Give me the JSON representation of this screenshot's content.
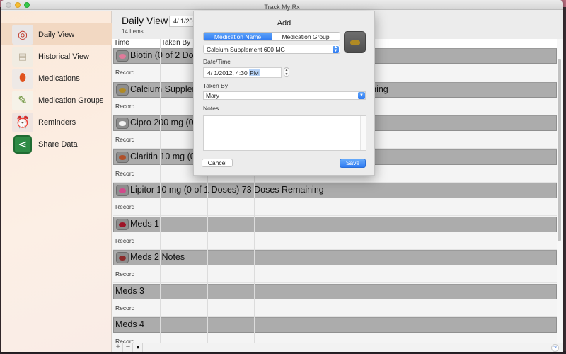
{
  "window": {
    "title": "Track My Rx"
  },
  "sidebar": {
    "items": [
      {
        "label": "Daily View",
        "icon": "calendar-pills-icon",
        "active": true
      },
      {
        "label": "Historical View",
        "icon": "history-paper-icon",
        "active": false
      },
      {
        "label": "Medications",
        "icon": "pill-bottle-icon",
        "active": false
      },
      {
        "label": "Medication Groups",
        "icon": "spoon-pills-icon",
        "active": false
      },
      {
        "label": "Reminders",
        "icon": "alarm-clock-icon",
        "active": false
      },
      {
        "label": "Share Data",
        "icon": "share-icon",
        "active": false
      }
    ]
  },
  "main": {
    "title": "Daily View",
    "date_value": "4/ 1/2012",
    "items_count": "14 Items",
    "columns": [
      "Time",
      "Taken By",
      "",
      ""
    ],
    "groups": [
      {
        "text": "Biotin (0 of 2 Doses)",
        "pill_color": "#e07a9a",
        "has_icon": true
      },
      {
        "text": "Calcium Supplement 600 MG (0 of 1 Doses) 98 Doses Remaining",
        "pill_color": "#b08a24",
        "has_icon": true
      },
      {
        "text": "Cipro 200 mg (0 of 2 Doses)",
        "pill_color": "#f4f4f4",
        "has_icon": true
      },
      {
        "text": "Claritin 10 mg (0 of 1 Doses)",
        "pill_color": "#b0502a",
        "has_icon": true
      },
      {
        "text": "Lipitor 10 mg (0 of 1 Doses) 73 Doses Remaining",
        "pill_color": "#d04a8a",
        "has_icon": true
      },
      {
        "text": "Meds 1",
        "pill_color": "#9e1428",
        "has_icon": true
      },
      {
        "text": "Meds 2 Notes",
        "pill_color": "#8a2a2a",
        "has_icon": true
      },
      {
        "text": "Meds 3",
        "pill_color": "",
        "has_icon": false
      },
      {
        "text": "Meds 4",
        "pill_color": "",
        "has_icon": false
      }
    ],
    "record_label": "Record",
    "bottom_bar": {
      "add": "+",
      "remove": "−",
      "action": "●",
      "help": "?"
    }
  },
  "dialog": {
    "title": "Add",
    "segments": [
      {
        "label": "Medication Name",
        "selected": true
      },
      {
        "label": "Medication Group",
        "selected": false
      }
    ],
    "medication_select": "Calcium Supplement 600 MG",
    "datetime_label": "Date/Time",
    "datetime_value": "4/ 1/2012,  4:30 ",
    "datetime_ampm": "PM",
    "taken_by_label": "Taken By",
    "taken_by_value": "Mary",
    "notes_label": "Notes",
    "notes_value": "",
    "cancel_label": "Cancel",
    "save_label": "Save",
    "accent_color": "#2f7bf2"
  }
}
